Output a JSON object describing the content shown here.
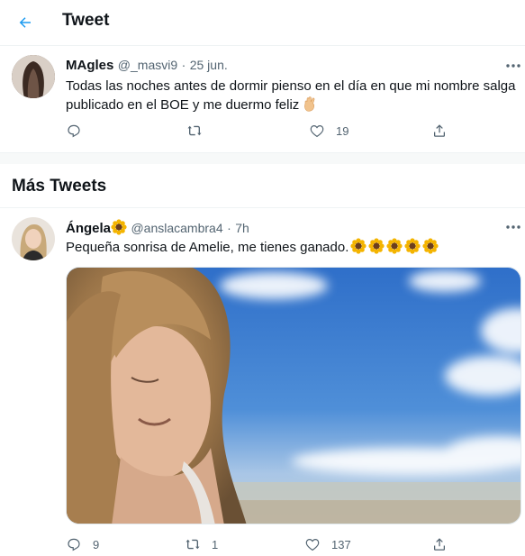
{
  "header": {
    "title": "Tweet"
  },
  "main_tweet": {
    "name": "MAgles",
    "handle": "@_masvi9",
    "separator": "·",
    "date": "25 jun.",
    "text": "Todas las noches antes de dormir pienso en el día en que mi nombre salga publicado en el BOE y me duermo feliz",
    "emoji": "fingers-crossed-icon",
    "likes": "19"
  },
  "section_title": "Más Tweets",
  "second_tweet": {
    "name": "Ángela",
    "name_emoji": "sunflower-icon",
    "handle": "@anslacambra4",
    "separator": "·",
    "time": "7h",
    "text": "Pequeña sonrisa de Amelie, me tienes ganado.",
    "text_emoji": "sunflower-icon",
    "text_emoji_count": 5,
    "replies": "9",
    "retweets": "1",
    "likes": "137"
  },
  "colors": {
    "accent": "#1d9bf0",
    "text": "#0f1419",
    "secondary": "#536471",
    "border": "#eff3f4",
    "sunflower_petal": "#f4b400",
    "sunflower_center": "#6b3e1e"
  }
}
